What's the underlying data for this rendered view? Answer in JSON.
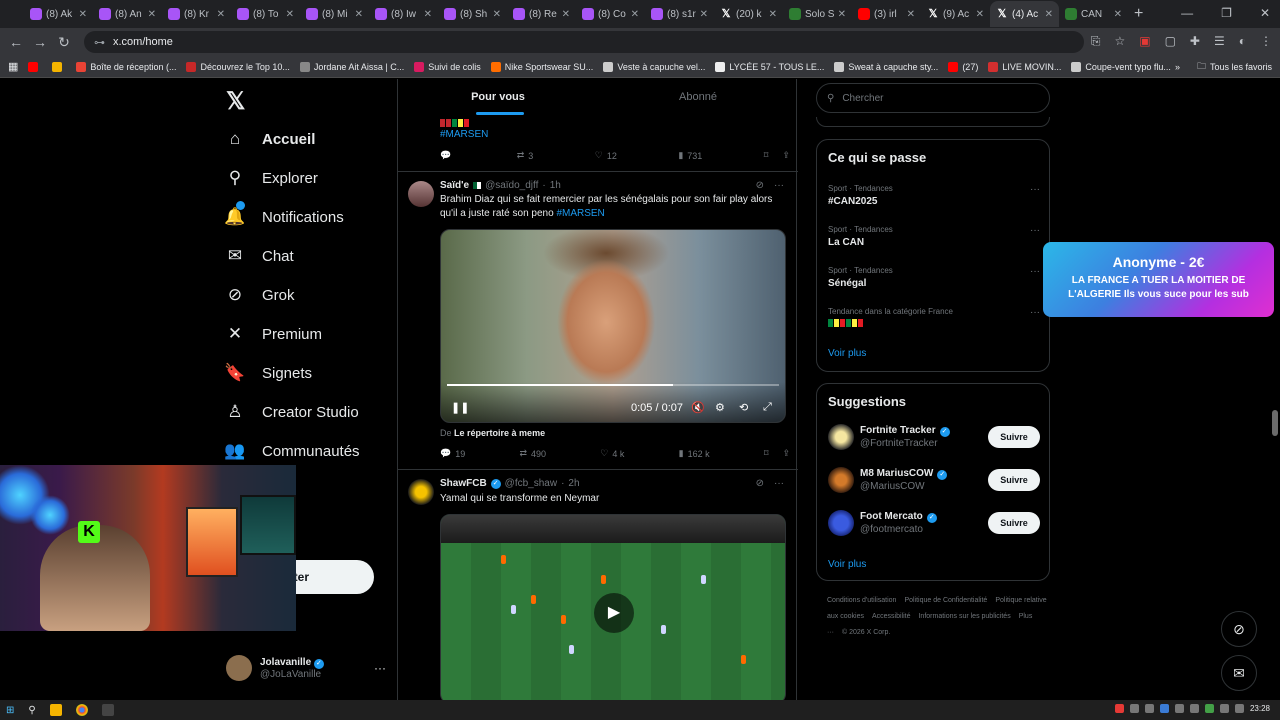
{
  "browser": {
    "tabs": [
      {
        "label": "(8) Ak",
        "icon": "purple-tab-icon",
        "active": false
      },
      {
        "label": "(8) An",
        "icon": "purple-tab-icon",
        "active": false
      },
      {
        "label": "(8) Kr",
        "icon": "purple-tab-icon",
        "active": false
      },
      {
        "label": "(8) To",
        "icon": "purple-tab-icon",
        "active": false
      },
      {
        "label": "(8) Mi",
        "icon": "purple-tab-icon",
        "active": false
      },
      {
        "label": "(8) Iw",
        "icon": "purple-tab-icon",
        "active": false
      },
      {
        "label": "(8) Sh",
        "icon": "purple-tab-icon",
        "active": false
      },
      {
        "label": "(8) Re",
        "icon": "purple-tab-icon",
        "active": false
      },
      {
        "label": "(8) Co",
        "icon": "purple-tab-icon",
        "active": false
      },
      {
        "label": "(8) s1r",
        "icon": "purple-tab-icon",
        "active": false
      },
      {
        "label": "(20) k",
        "icon": "x-tab-icon",
        "active": false
      },
      {
        "label": "Solo S",
        "icon": "green-tab-icon",
        "active": false
      },
      {
        "label": "(3) irl",
        "icon": "youtube-tab-icon",
        "active": false
      },
      {
        "label": "(9) Ac",
        "icon": "x-tab-icon",
        "active": false
      },
      {
        "label": "(4) Ac",
        "icon": "x-tab-icon",
        "active": true
      },
      {
        "label": "CAN",
        "icon": "green-tab-icon",
        "active": false
      }
    ],
    "url": "x.com/home",
    "bookmarks": [
      {
        "label": "",
        "color": "#ff0000"
      },
      {
        "label": "",
        "color": "#f4b400"
      },
      {
        "label": "Boîte de réception (...",
        "color": "#ea4335"
      },
      {
        "label": "Découvrez le Top 10...",
        "color": "#c62828"
      },
      {
        "label": "Jordane Ait Aissa | C...",
        "color": "#888888"
      },
      {
        "label": "Suivi de colis",
        "color": "#d81b60"
      },
      {
        "label": "Nike Sportswear SU...",
        "color": "#ff6d00"
      },
      {
        "label": "Veste à capuche vel...",
        "color": "#cccccc"
      },
      {
        "label": "LYCÉE 57 - TOUS LE...",
        "color": "#eeeeee"
      },
      {
        "label": "Sweat à capuche sty...",
        "color": "#cccccc"
      },
      {
        "label": "(27)",
        "color": "#ff0000"
      },
      {
        "label": "LIVE MOVIN...",
        "color": "#d32f2f"
      },
      {
        "label": "Coupe-vent typo flu...",
        "color": "#cccccc"
      }
    ],
    "bookmarks_all": "Tous les favoris"
  },
  "nav": {
    "items": [
      {
        "label": "Accueil",
        "icon": "home-icon",
        "glyph": "⌂"
      },
      {
        "label": "Explorer",
        "icon": "search-icon",
        "glyph": "⚲"
      },
      {
        "label": "Notifications",
        "icon": "bell-icon",
        "glyph": "🔔"
      },
      {
        "label": "Chat",
        "icon": "mail-icon",
        "glyph": "✉"
      },
      {
        "label": "Grok",
        "icon": "grok-icon",
        "glyph": "⊘"
      },
      {
        "label": "Premium",
        "icon": "x-icon",
        "glyph": "✕"
      },
      {
        "label": "Signets",
        "icon": "bookmark-icon",
        "glyph": "🔖"
      },
      {
        "label": "Creator Studio",
        "icon": "creator-icon",
        "glyph": "♙"
      },
      {
        "label": "Communautés",
        "icon": "communities-icon",
        "glyph": "👥"
      }
    ],
    "notif_count": "4",
    "post_button": "ster",
    "profile": {
      "display_name": "Jolavanille",
      "username": "@JoLaVanille"
    }
  },
  "feed": {
    "tabs": [
      "Pour vous",
      "Abonné"
    ],
    "prev_tweet": {
      "hashtag": "#MARSEN",
      "replies": "",
      "retweets": "3",
      "likes": "12",
      "views": "731"
    },
    "tweet1": {
      "display_name": "Saïd'e",
      "handle": "@saïdo_djff",
      "time": "1h",
      "text": "Brahim Diaz qui se fait remercier par les sénégalais pour son fair play alors qu'il a juste raté son peno",
      "hashtag": "#MARSEN",
      "video_time": "0:05 / 0:07",
      "progress": 0.68,
      "source_prefix": "De",
      "source_name": "Le répertoire à meme",
      "replies": "19",
      "retweets": "490",
      "likes": "4 k",
      "views": "162 k"
    },
    "tweet2": {
      "display_name": "ShawFCB",
      "handle": "@fcb_shaw",
      "time": "2h",
      "text": "Yamal qui se transforme en Neymar"
    }
  },
  "right": {
    "search_placeholder": "Chercher",
    "happening_title": "Ce qui se passe",
    "trends": [
      {
        "sub": "Sport · Tendances",
        "title": "#CAN2025"
      },
      {
        "sub": "Sport · Tendances",
        "title": "La CAN"
      },
      {
        "sub": "Sport · Tendances",
        "title": "Sénégal"
      },
      {
        "sub": "Tendance dans la catégorie France",
        "title": ""
      }
    ],
    "see_more": "Voir plus",
    "suggestions_title": "Suggestions",
    "suggestions": [
      {
        "name": "Fortnite Tracker",
        "handle": "@FortniteTracker",
        "button": "Suivre"
      },
      {
        "name": "M8 MariusCOW",
        "handle": "@MariusCOW",
        "button": "Suivre"
      },
      {
        "name": "Foot Mercato",
        "handle": "@footmercato",
        "button": "Suivre"
      }
    ],
    "see_more_2": "Voir plus",
    "footer": [
      "Conditions d'utilisation",
      "Politique de Confidentialité",
      "Politique relative aux cookies",
      "Accessibilité",
      "Informations sur les publicités",
      "Plus ···",
      "© 2026 X Corp."
    ]
  },
  "donation": {
    "title": "Anonyme - 2€",
    "message": "LA FRANCE A TUER LA MOITIER DE L'ALGERIE Ils vous suce pour les sub"
  },
  "overlay": {
    "kick_letter": "K"
  },
  "taskbar": {
    "time": "23:28"
  },
  "colors": {
    "accent": "#1d9bf0",
    "background": "#000000",
    "border": "#2f3336"
  }
}
